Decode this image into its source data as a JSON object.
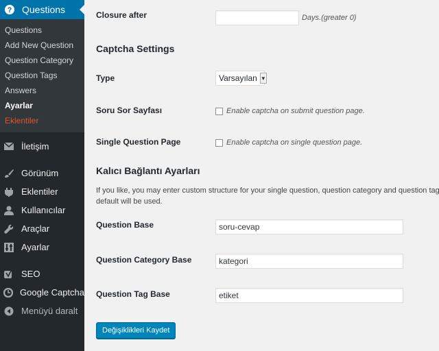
{
  "sidebar": {
    "active_menu": "Questions",
    "submenu": [
      "Questions",
      "Add New Question",
      "Question Category",
      "Question Tags",
      "Answers",
      "Ayarlar",
      "Eklentiler"
    ],
    "menu_items": [
      {
        "label": "İletişim",
        "icon": "mail-icon"
      },
      {
        "label": "Görünüm",
        "icon": "brush-icon"
      },
      {
        "label": "Eklentiler",
        "icon": "plugin-icon"
      },
      {
        "label": "Kullanıcılar",
        "icon": "user-icon"
      },
      {
        "label": "Araçlar",
        "icon": "wrench-icon"
      },
      {
        "label": "Ayarlar",
        "icon": "settings-icon"
      },
      {
        "label": "SEO",
        "icon": "yoast-icon"
      },
      {
        "label": "Google Captcha",
        "icon": "captcha-icon"
      },
      {
        "label": "Menüyü daralt",
        "icon": "collapse-icon"
      }
    ]
  },
  "form": {
    "closure_label": "Closure after",
    "closure_value": "",
    "closure_hint": "Days.(greater 0)",
    "captcha_heading": "Captcha Settings",
    "type_label": "Type",
    "type_value": "Varsayılan",
    "ask_page_label": "Soru Sor Sayfası",
    "ask_page_checkbox": "Enable captcha on submit question page.",
    "single_page_label": "Single Question Page",
    "single_page_checkbox": "Enable captcha on single question page.",
    "permalink_heading": "Kalıcı Bağlantı Ayarları",
    "permalink_desc_1": "If you like, you may enter custom structure for your single question, question category and question tag URLs",
    "permalink_desc_2": "default will be used.",
    "question_base_label": "Question Base",
    "question_base_value": "soru-cevap",
    "category_base_label": "Question Category Base",
    "category_base_value": "kategori",
    "tag_base_label": "Question Tag Base",
    "tag_base_value": "etiket",
    "save_label": "Değişiklikleri Kaydet"
  },
  "colors": {
    "sidebar_bg": "#23282d",
    "active_menu_bg": "#0073aa",
    "button_bg": "#0085ba",
    "plugins_submenu_text": "#e2532c"
  }
}
